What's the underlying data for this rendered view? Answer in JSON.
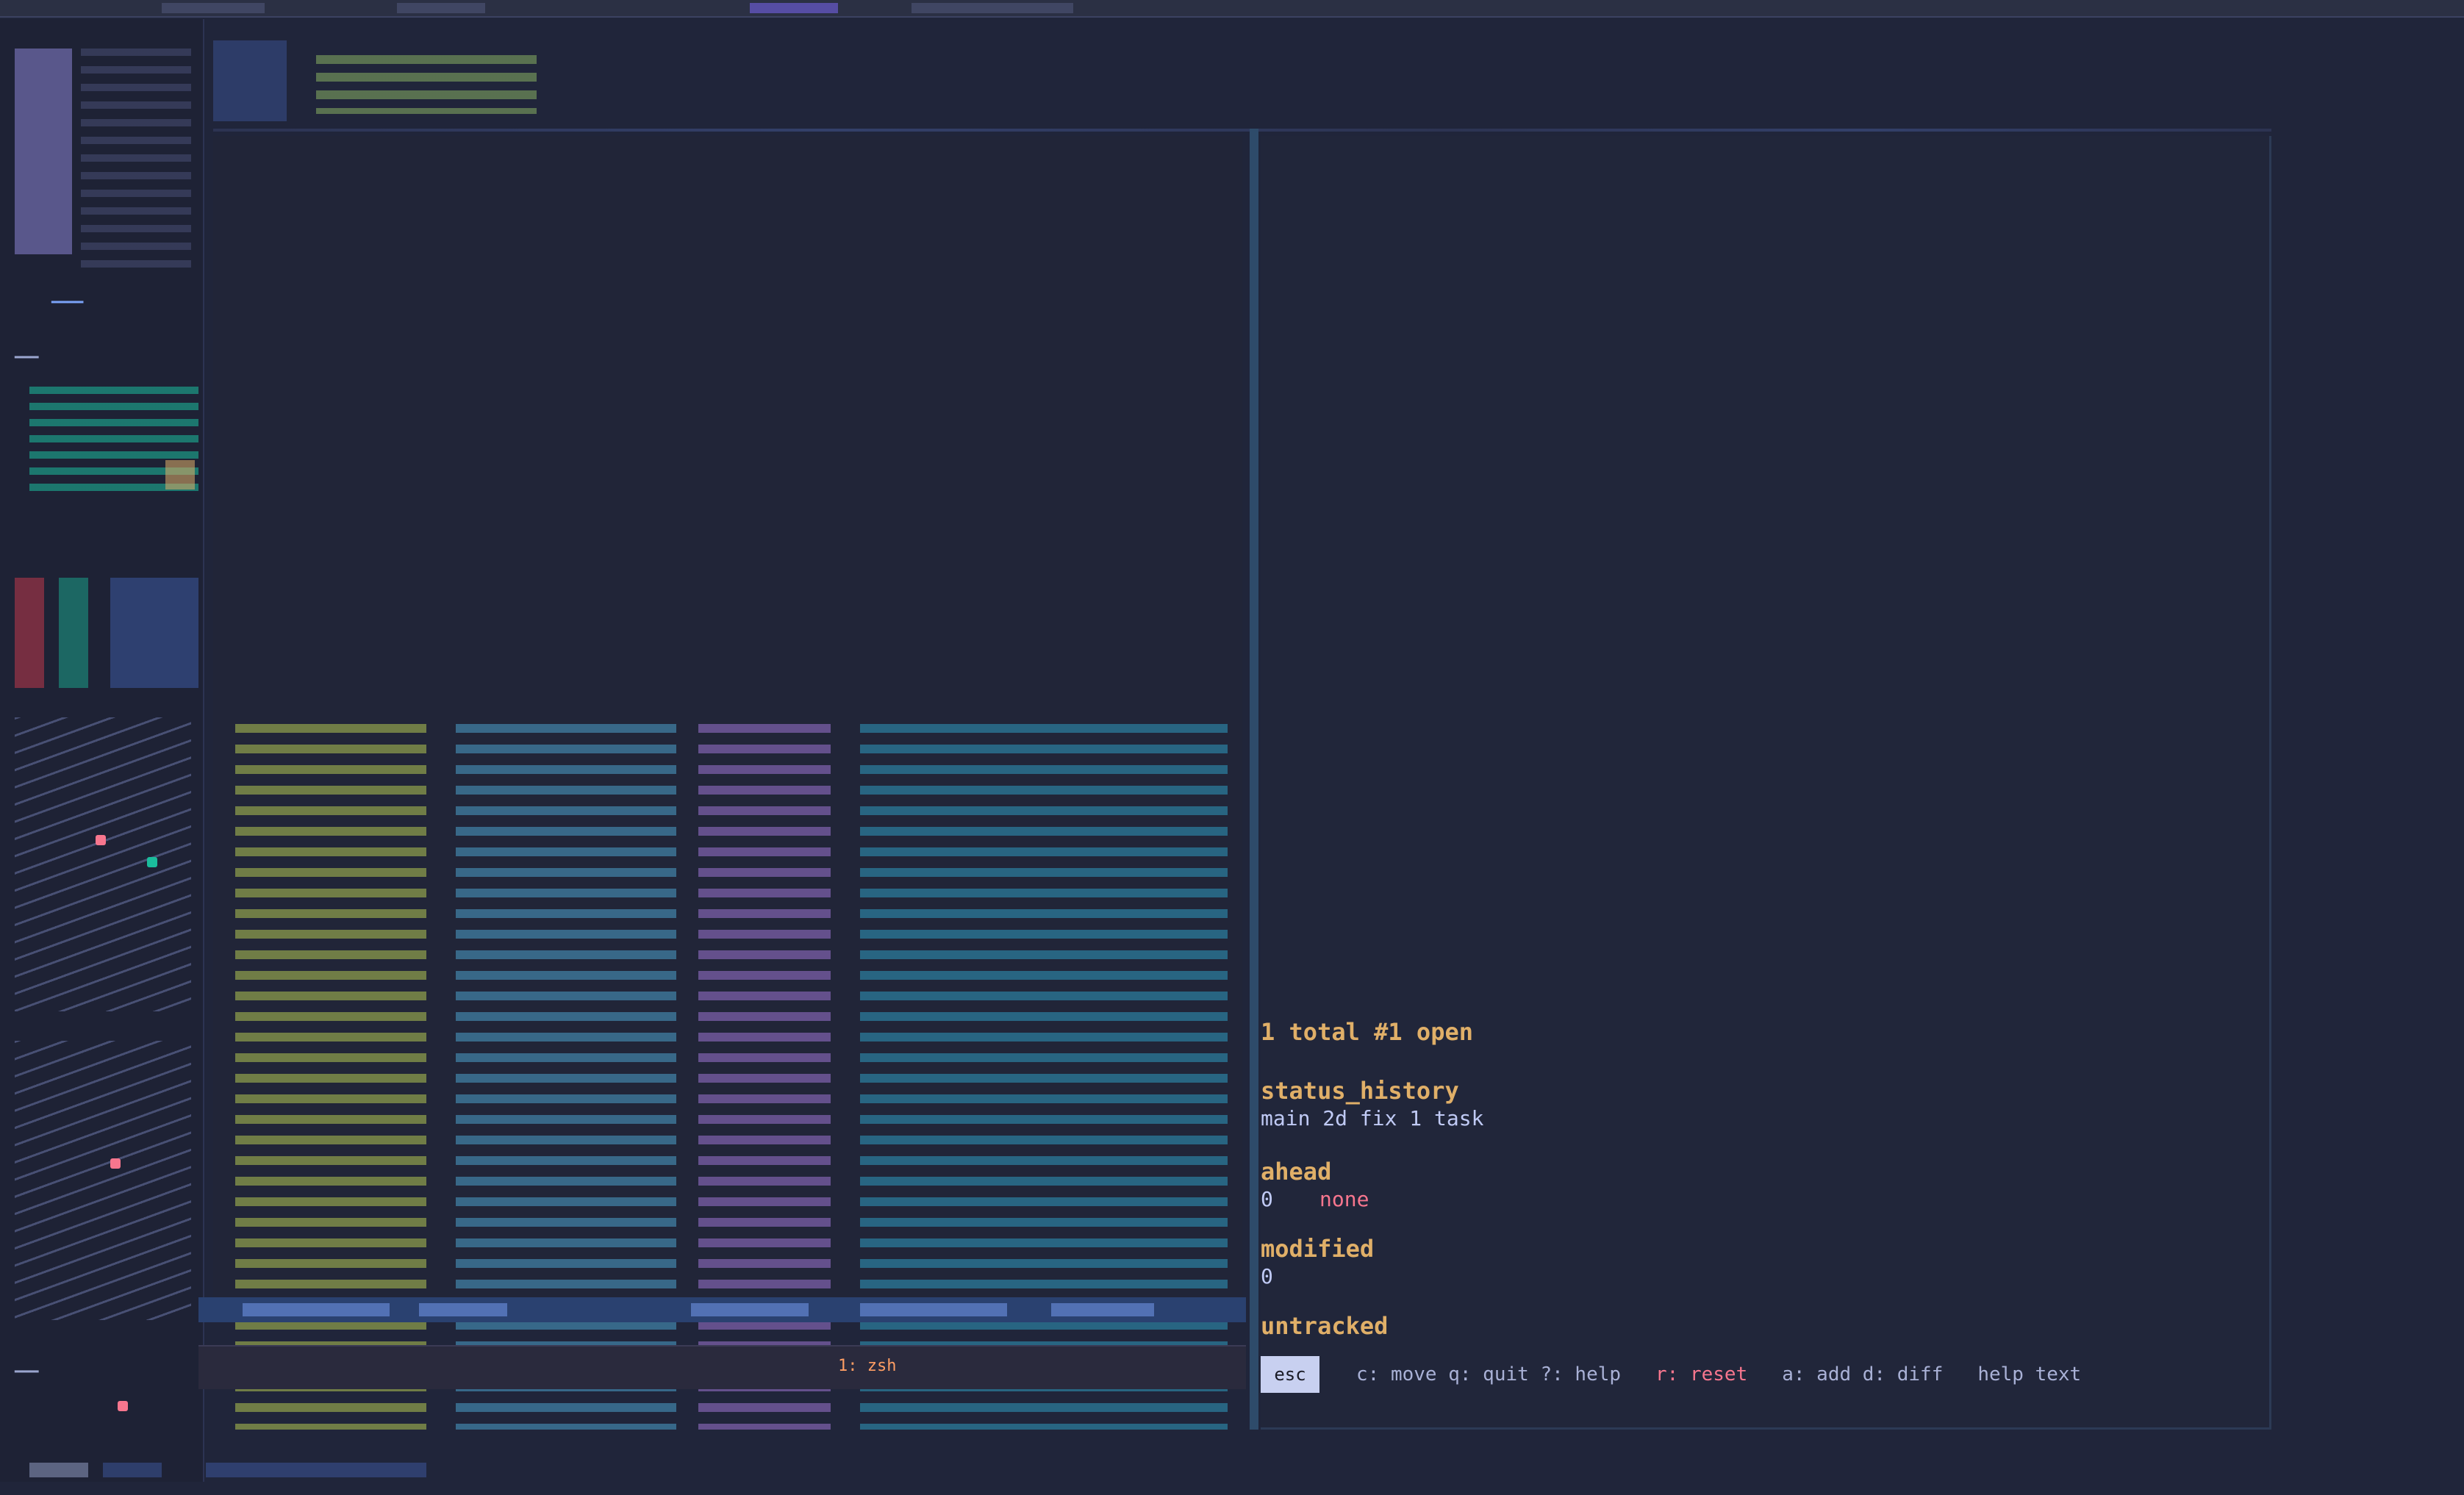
{
  "right_pane": {
    "header_line": "1 total   #1 open",
    "status_title": "status_history",
    "status_value": "main  2d  fix  1 task",
    "label_a": "ahead",
    "label_a_value": "0",
    "label_a_badge": "none",
    "label_b": "modified",
    "label_b_value": "0",
    "label_c": "untracked",
    "prompt_button": "esc",
    "help_hint": "c: move  q: quit  ?: help",
    "help_red": "r: reset",
    "help_tail": "a: add  d: diff",
    "help_end": "help text"
  },
  "cmdline": {
    "prompt": "1: zsh"
  },
  "colors": {
    "background": "#20253a",
    "accent_blue": "#7aa2f7",
    "accent_orange": "#e0af68",
    "accent_red": "#f7768e",
    "accent_green": "#9ece6a",
    "accent_purple": "#7a5ea8",
    "accent_teal": "#2b7a9a"
  }
}
